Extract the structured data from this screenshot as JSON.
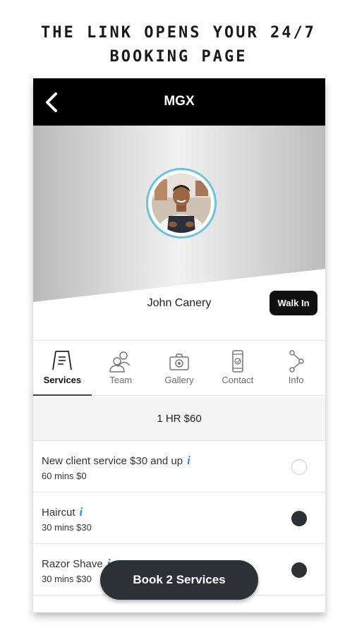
{
  "headline": {
    "line1": "THE LINK OPENS YOUR 24/7",
    "line2": "BOOKING PAGE"
  },
  "header": {
    "back_icon": "chevron-left-icon",
    "title": "MGX"
  },
  "profile": {
    "name": "John Canery",
    "walk_in_label": "Walk In",
    "avatar_ring_color": "#6cc3e0"
  },
  "tabs": [
    {
      "label": "Services",
      "icon": "sign-board-icon",
      "active": true
    },
    {
      "label": "Team",
      "icon": "team-icon",
      "active": false
    },
    {
      "label": "Gallery",
      "icon": "camera-icon",
      "active": false
    },
    {
      "label": "Contact",
      "icon": "phone-icon",
      "active": false
    },
    {
      "label": "Info",
      "icon": "share-icon",
      "active": false
    }
  ],
  "price_banner": "1 HR $60",
  "services": [
    {
      "name": "New client service $30 and up",
      "meta": "60 mins $0",
      "selected": false
    },
    {
      "name": "Haircut",
      "meta": "30 mins $30",
      "selected": true
    },
    {
      "name": "Razor Shave",
      "meta": "30 mins $30",
      "selected": true
    }
  ],
  "info_glyph": "i",
  "book_button_label": "Book 2 Services",
  "colors": {
    "topbar": "#000000",
    "info_accent": "#2f8fd6",
    "selected_radio": "#2d3035",
    "book_button": "#2d3137"
  }
}
